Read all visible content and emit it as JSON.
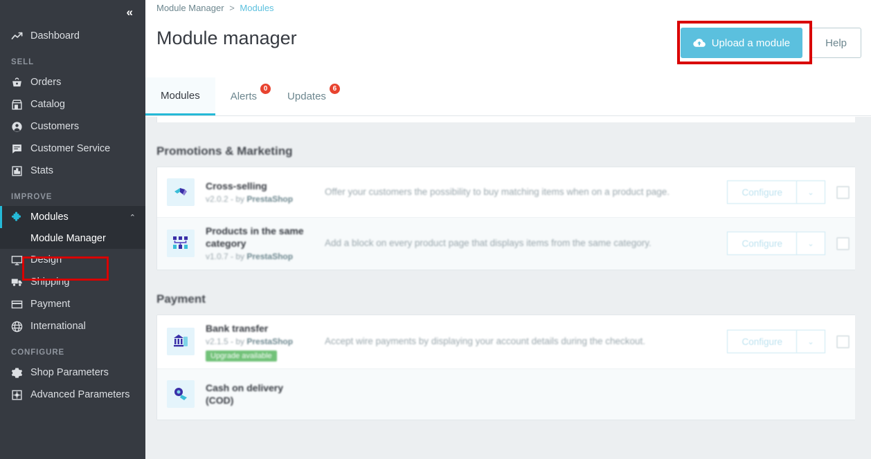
{
  "sidebar": {
    "collapse_icon": "«",
    "dashboard": {
      "label": "Dashboard",
      "icon": "trending-up-icon"
    },
    "sections": [
      {
        "title": "SELL",
        "items": [
          {
            "label": "Orders",
            "icon": "basket-icon"
          },
          {
            "label": "Catalog",
            "icon": "store-icon"
          },
          {
            "label": "Customers",
            "icon": "person-circle-icon"
          },
          {
            "label": "Customer Service",
            "icon": "chat-icon"
          },
          {
            "label": "Stats",
            "icon": "bar-chart-icon"
          }
        ]
      },
      {
        "title": "IMPROVE",
        "items": [
          {
            "label": "Modules",
            "icon": "puzzle-icon",
            "active": true,
            "caret": "⌃",
            "children": [
              {
                "label": "Module Manager",
                "highlighted": true
              }
            ]
          },
          {
            "label": "Design",
            "icon": "monitor-icon"
          },
          {
            "label": "Shipping",
            "icon": "truck-icon"
          },
          {
            "label": "Payment",
            "icon": "credit-card-icon"
          },
          {
            "label": "International",
            "icon": "globe-icon"
          }
        ]
      },
      {
        "title": "CONFIGURE",
        "items": [
          {
            "label": "Shop Parameters",
            "icon": "gear-icon"
          },
          {
            "label": "Advanced Parameters",
            "icon": "sliders-icon"
          }
        ]
      }
    ]
  },
  "header": {
    "breadcrumb": {
      "parent": "Module Manager",
      "separator": ">",
      "current": "Modules"
    },
    "title": "Module manager",
    "upload_label": "Upload a module",
    "upload_icon": "cloud-upload-icon",
    "help_label": "Help"
  },
  "tabs": [
    {
      "label": "Modules",
      "badge": null,
      "active": true
    },
    {
      "label": "Alerts",
      "badge": "0",
      "active": false
    },
    {
      "label": "Updates",
      "badge": "6",
      "active": false
    }
  ],
  "groups": [
    {
      "title": "Promotions & Marketing",
      "modules": [
        {
          "name": "Cross-selling",
          "version": "v2.0.2 - by",
          "author": "PrestaShop",
          "description": "Offer your customers the possibility to buy matching items when on a product page.",
          "badge": null,
          "configure_label": "Configure",
          "caret": "⌄",
          "icon": "cross-selling-icon"
        },
        {
          "name": "Products in the same category",
          "version": "v1.0.7 - by",
          "author": "PrestaShop",
          "description": "Add a block on every product page that displays items from the same category.",
          "badge": null,
          "configure_label": "Configure",
          "caret": "⌄",
          "icon": "category-grid-icon"
        }
      ]
    },
    {
      "title": "Payment",
      "modules": [
        {
          "name": "Bank transfer",
          "version": "v2.1.5 - by",
          "author": "PrestaShop",
          "description": "Accept wire payments by displaying your account details during the checkout.",
          "badge": "Upgrade available",
          "configure_label": "Configure",
          "caret": "⌄",
          "icon": "bank-icon"
        },
        {
          "name": "Cash on delivery (COD)",
          "version": "",
          "author": "",
          "description": "",
          "badge": null,
          "configure_label": "",
          "caret": "",
          "icon": "cod-icon"
        }
      ]
    }
  ],
  "colors": {
    "sidebar_bg": "#363a41",
    "accent": "#25b9d7",
    "primary_button": "#5bc0de",
    "highlight_box": "#d90000",
    "badge_red": "#e8432f",
    "badge_green": "#72c279"
  }
}
